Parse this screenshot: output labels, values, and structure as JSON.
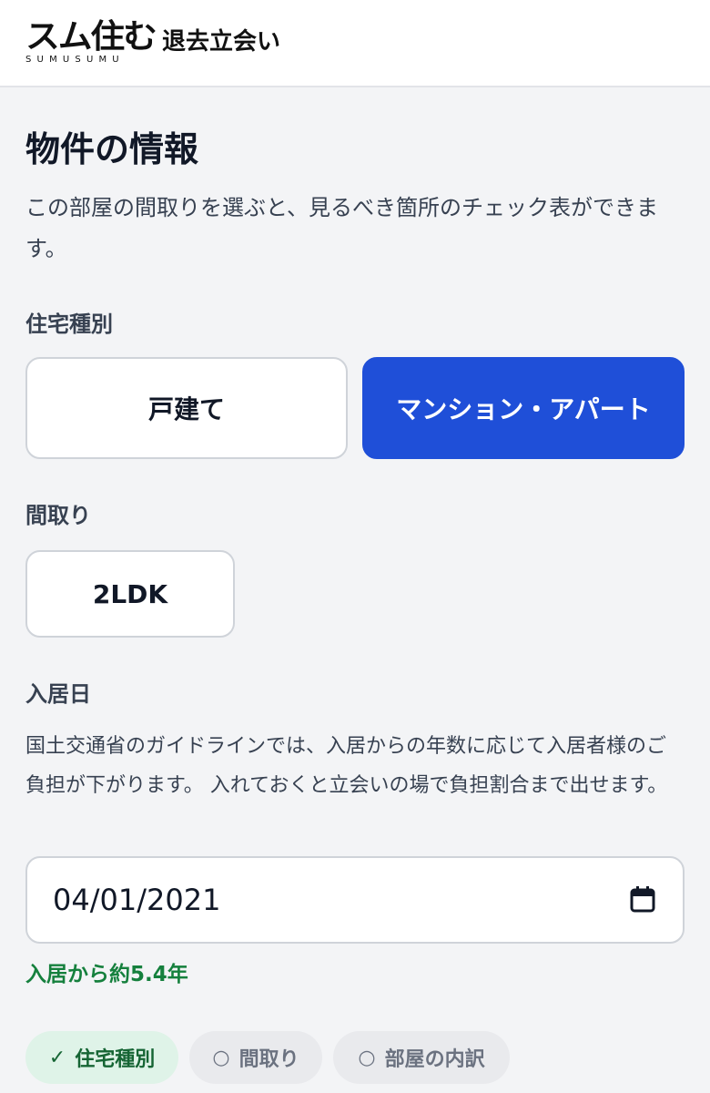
{
  "header": {
    "logo_main": "スム住む",
    "logo_sub": "SUMUSUMU",
    "app_title": "退去立会い"
  },
  "page": {
    "title": "物件の情報",
    "description": "この部屋の間取りを選ぶと、見るべき箇所のチェック表ができます。"
  },
  "housing_type": {
    "label": "住宅種別",
    "options": [
      {
        "label": "戸建て",
        "selected": false
      },
      {
        "label": "マンション・アパート",
        "selected": true
      }
    ]
  },
  "floor_plan": {
    "label": "間取り",
    "value": "2LDK"
  },
  "move_in": {
    "label": "入居日",
    "guide": "国土交通省のガイドラインでは、入居からの年数に応じて入居者様のご負担が下がります。 入れておくと立会いの場で負担割合まで出せます。",
    "date_value": "04/01/2021",
    "years_note": "入居から約5.4年"
  },
  "steps": [
    {
      "mark": "✓",
      "label": "住宅種別",
      "status": "done"
    },
    {
      "mark": "○",
      "label": "間取り",
      "status": "todo"
    },
    {
      "mark": "○",
      "label": "部屋の内訳",
      "status": "todo"
    }
  ],
  "colors": {
    "accent": "#1f4fd8",
    "success": "#15803d",
    "background": "#f3f4f6"
  },
  "icons": {
    "date_picker": "calendar-icon"
  }
}
